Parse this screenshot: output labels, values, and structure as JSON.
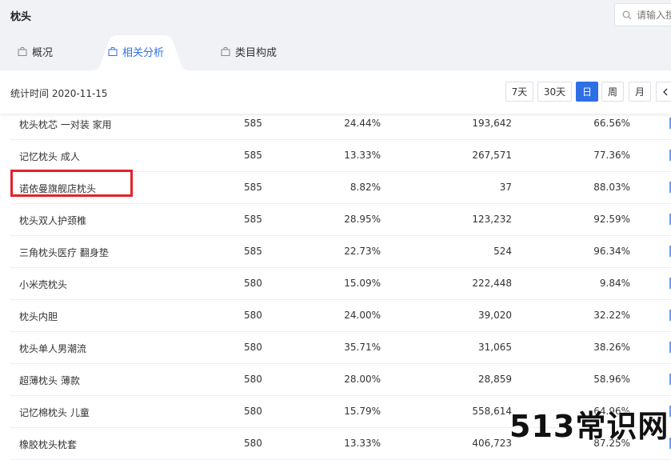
{
  "header": {
    "title": "枕头",
    "search_placeholder": "请输入搜"
  },
  "tabs": [
    {
      "label": "概况",
      "active": false
    },
    {
      "label": "相关分析",
      "active": true
    },
    {
      "label": "类目构成",
      "active": false
    }
  ],
  "toolbar": {
    "stat_time": "统计时间 2020-11-15",
    "periods": [
      "7天",
      "30天",
      "日",
      "周",
      "月"
    ],
    "active_period": "日",
    "prev_icon": "chevron-left-icon"
  },
  "table": {
    "rows": [
      {
        "keyword": "枕头枕芯 一对装 家用",
        "rank": "585",
        "pct1": "24.44%",
        "num": "193,642",
        "pct2": "66.56%"
      },
      {
        "keyword": "记忆枕头 成人",
        "rank": "585",
        "pct1": "13.33%",
        "num": "267,571",
        "pct2": "77.36%"
      },
      {
        "keyword": "诺依曼旗舰店枕头",
        "rank": "585",
        "pct1": "8.82%",
        "num": "37",
        "pct2": "88.03%"
      },
      {
        "keyword": "枕头双人护颈椎",
        "rank": "585",
        "pct1": "28.95%",
        "num": "123,232",
        "pct2": "92.59%"
      },
      {
        "keyword": "三角枕头医疗 翻身垫",
        "rank": "585",
        "pct1": "22.73%",
        "num": "524",
        "pct2": "96.34%"
      },
      {
        "keyword": "小米壳枕头",
        "rank": "580",
        "pct1": "15.09%",
        "num": "222,448",
        "pct2": "9.84%"
      },
      {
        "keyword": "枕头内胆",
        "rank": "580",
        "pct1": "24.00%",
        "num": "39,020",
        "pct2": "32.22%"
      },
      {
        "keyword": "枕头单人男潮流",
        "rank": "580",
        "pct1": "35.71%",
        "num": "31,065",
        "pct2": "38.26%"
      },
      {
        "keyword": "超薄枕头 薄款",
        "rank": "580",
        "pct1": "28.00%",
        "num": "28,859",
        "pct2": "58.96%"
      },
      {
        "keyword": "记忆棉枕头 儿童",
        "rank": "580",
        "pct1": "15.79%",
        "num": "558,614",
        "pct2": "64.96%"
      },
      {
        "keyword": "橡胶枕头枕套",
        "rank": "580",
        "pct1": "13.33%",
        "num": "406,723",
        "pct2": "87.25%"
      }
    ],
    "highlighted_keyword": "诺依曼旗舰店枕头"
  },
  "watermark": "513常识网",
  "colors": {
    "accent": "#2f6fe4",
    "highlight": "#e4222b",
    "header_bg": "#f0f2f5"
  }
}
